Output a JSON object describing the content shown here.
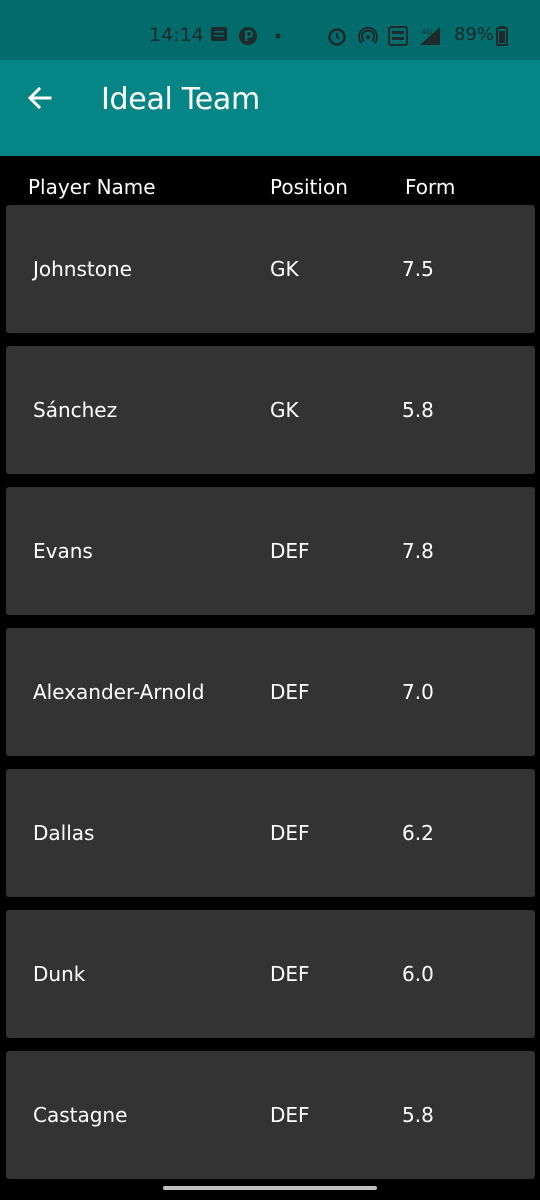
{
  "status_bar": {
    "time": "14:14",
    "battery": "89%",
    "icons": [
      "message-icon",
      "app-icon",
      "dot-icon",
      "alarm-icon",
      "hotspot-icon",
      "volte-icon",
      "signal-icon",
      "battery-icon"
    ]
  },
  "app_bar": {
    "title": "Ideal Team",
    "back_icon": "arrow-left-icon"
  },
  "table": {
    "headers": {
      "name": "Player Name",
      "position": "Position",
      "form": "Form"
    },
    "rows": [
      {
        "name": "Johnstone",
        "position": "GK",
        "form": "7.5"
      },
      {
        "name": "Sánchez",
        "position": "GK",
        "form": "5.8"
      },
      {
        "name": "Evans",
        "position": "DEF",
        "form": "7.8"
      },
      {
        "name": "Alexander-Arnold",
        "position": "DEF",
        "form": "7.0"
      },
      {
        "name": "Dallas",
        "position": "DEF",
        "form": "6.2"
      },
      {
        "name": "Dunk",
        "position": "DEF",
        "form": "6.0"
      },
      {
        "name": "Castagne",
        "position": "DEF",
        "form": "5.8"
      }
    ]
  },
  "colors": {
    "status_bar": "#026b6b",
    "app_bar": "#058585",
    "row_bg": "#333333",
    "background": "#000000"
  }
}
